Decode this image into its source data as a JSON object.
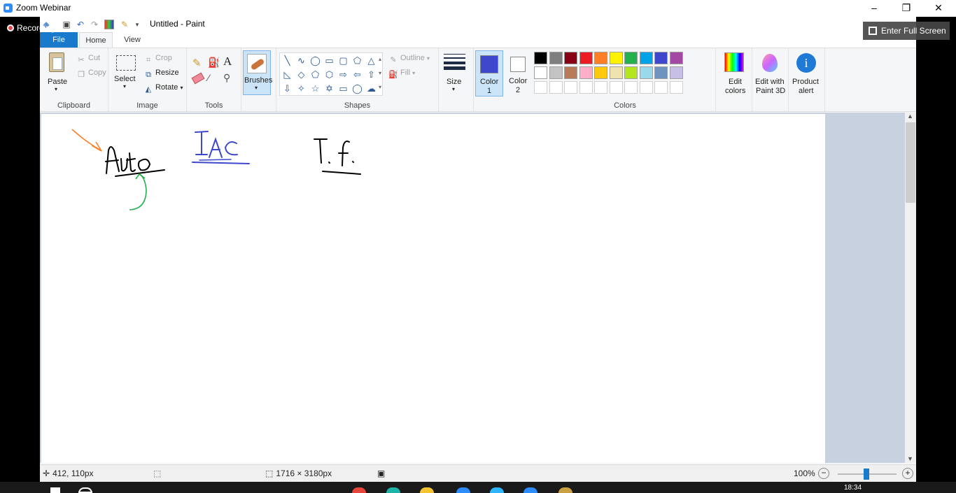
{
  "zoom": {
    "title": "Zoom Webinar",
    "recording": "Recording",
    "fullscreen": "Enter Full Screen",
    "controls": {
      "minimize": "–",
      "restore": "❐",
      "close": "✕"
    }
  },
  "paint": {
    "doc_title": "Untitled - Paint",
    "tabs": {
      "file": "File",
      "home": "Home",
      "view": "View"
    },
    "clipboard": {
      "paste": "Paste",
      "cut": "Cut",
      "copy": "Copy",
      "label": "Clipboard"
    },
    "image": {
      "select": "Select",
      "crop": "Crop",
      "resize": "Resize",
      "rotate": "Rotate",
      "label": "Image"
    },
    "tools": {
      "label": "Tools"
    },
    "brushes": {
      "label": "Brushes"
    },
    "shapes": {
      "outline": "Outline",
      "fill": "Fill",
      "label": "Shapes"
    },
    "size": {
      "label": "Size"
    },
    "color1": {
      "label": "Color",
      "num": "1",
      "value": "#3f48cc"
    },
    "color2": {
      "label": "Color",
      "num": "2",
      "value": "#ffffff"
    },
    "colors": {
      "label": "Colors",
      "row1": [
        "#000000",
        "#7f7f7f",
        "#880015",
        "#ed1c24",
        "#ff7f27",
        "#fff200",
        "#22b14c",
        "#00a2e8",
        "#3f48cc",
        "#a349a4"
      ],
      "row2": [
        "#ffffff",
        "#c3c3c3",
        "#b97a57",
        "#ffaec9",
        "#ffc90e",
        "#efe4b0",
        "#b5e61d",
        "#99d9ea",
        "#7092be",
        "#c8bfe7"
      ]
    },
    "edit_colors": {
      "line1": "Edit",
      "line2": "colors"
    },
    "paint3d": {
      "line1": "Edit with",
      "line2": "Paint 3D"
    },
    "product_alert": {
      "line1": "Product",
      "line2": "alert"
    },
    "status": {
      "position": "412, 110px",
      "canvas_size": "1716 × 3180px",
      "zoom": "100%"
    }
  },
  "drawing": {
    "words": [
      "Auto",
      "IAC",
      "I.f."
    ],
    "colors": {
      "black": "#000000",
      "blue": "#3f48cc",
      "orange": "#ff7f27",
      "green": "#22b14c"
    }
  },
  "taskbar": {
    "time": "18:34"
  }
}
